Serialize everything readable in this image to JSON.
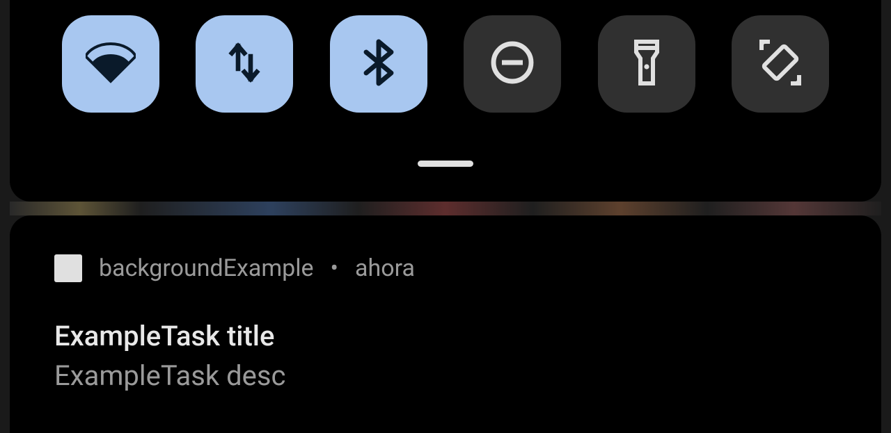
{
  "quickSettings": {
    "tiles": [
      {
        "name": "wifi",
        "active": true
      },
      {
        "name": "mobile-data",
        "active": true
      },
      {
        "name": "bluetooth",
        "active": true
      },
      {
        "name": "do-not-disturb",
        "active": false
      },
      {
        "name": "flashlight",
        "active": false
      },
      {
        "name": "auto-rotate",
        "active": false
      }
    ]
  },
  "notification": {
    "appName": "backgroundExample",
    "separator": "•",
    "time": "ahora",
    "title": "ExampleTask title",
    "description": "ExampleTask desc"
  }
}
